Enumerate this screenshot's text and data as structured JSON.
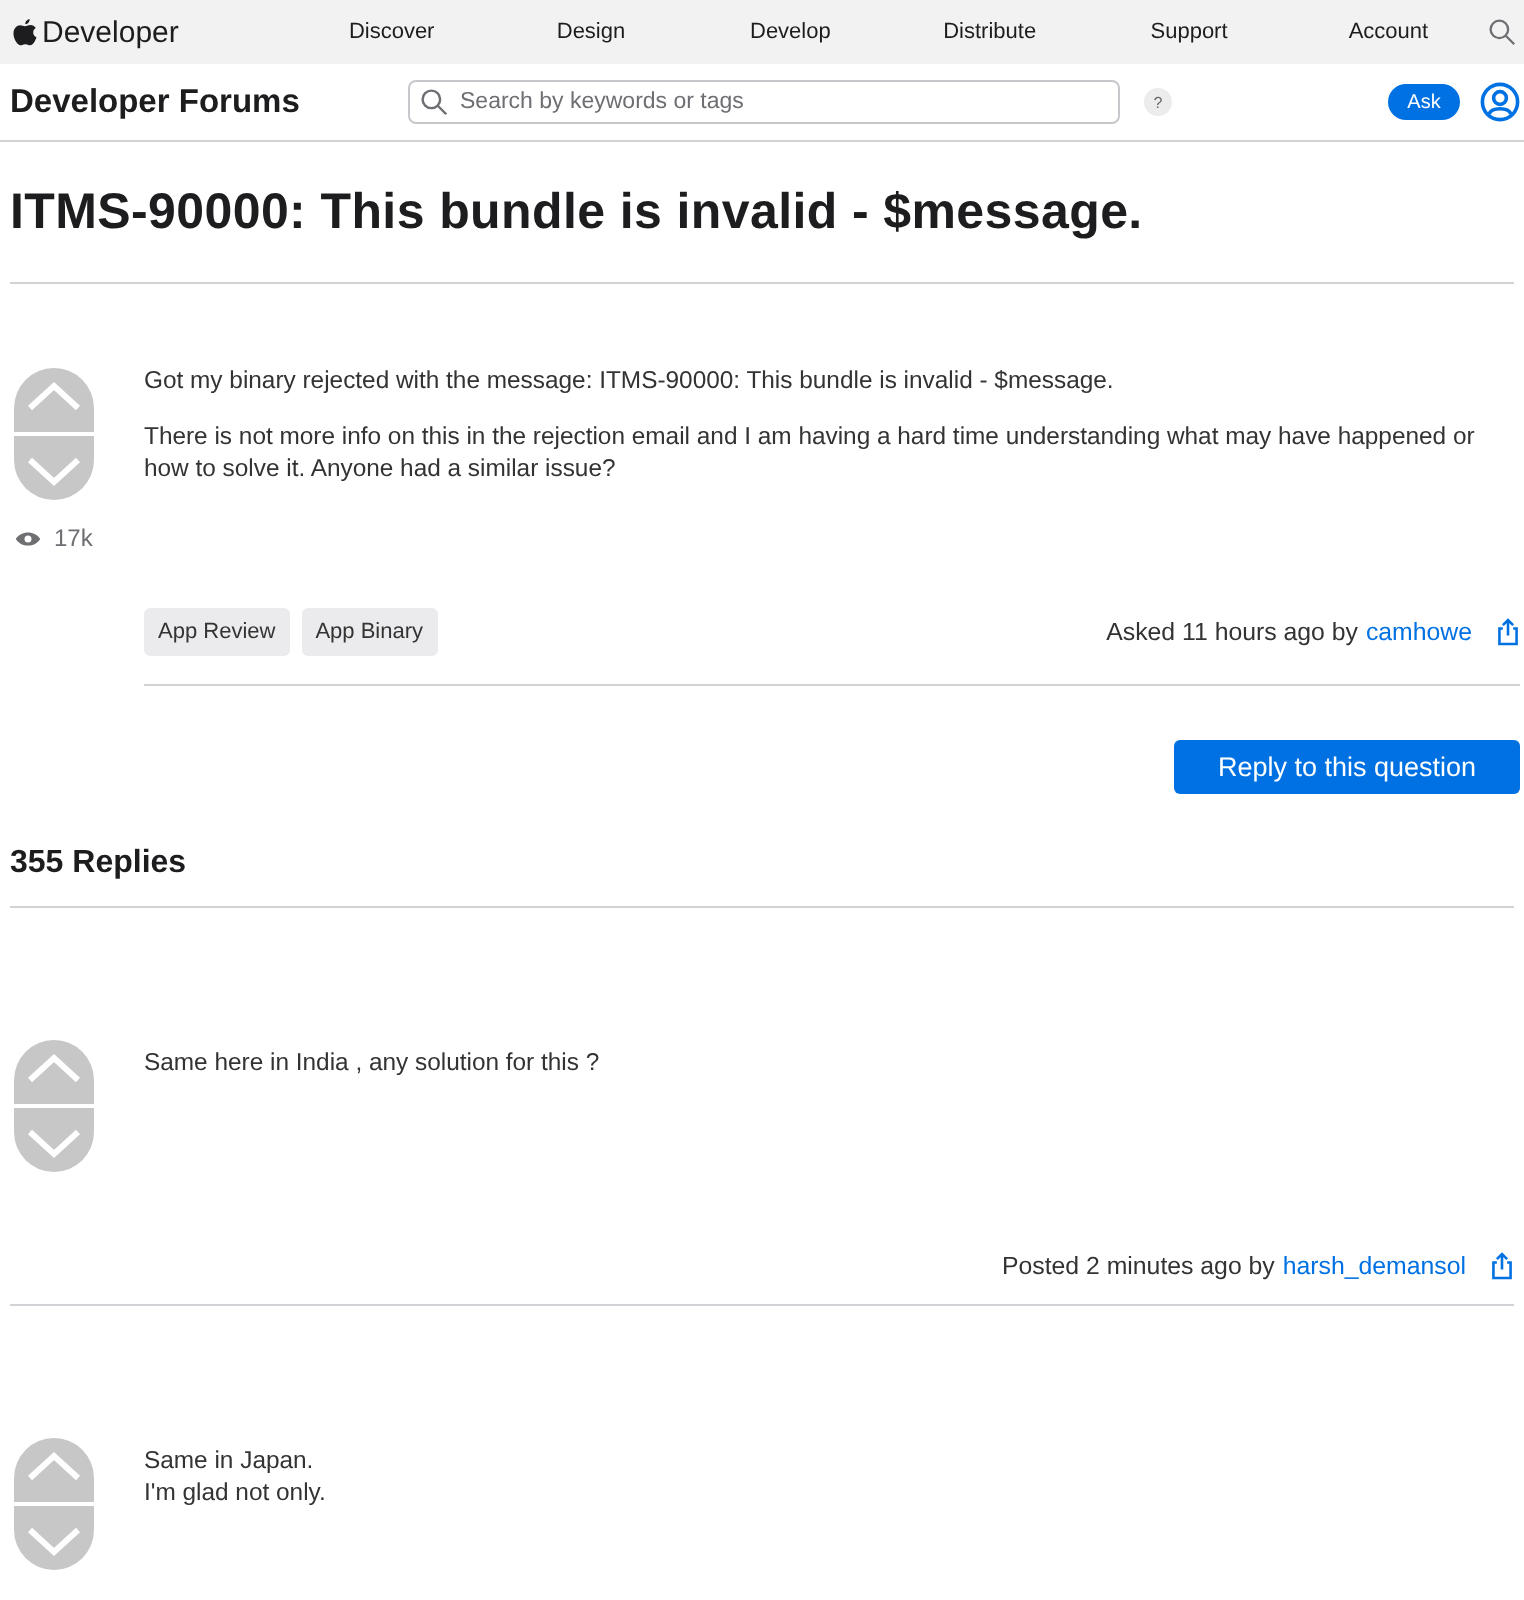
{
  "global_nav": {
    "brand": "Developer",
    "links": [
      "Discover",
      "Design",
      "Develop",
      "Distribute",
      "Support",
      "Account"
    ]
  },
  "forum_bar": {
    "title": "Developer Forums",
    "search": {
      "placeholder": "Search by keywords or tags"
    },
    "help": "?",
    "ask_button": "Ask"
  },
  "question": {
    "title": "ITMS-90000: This bundle is invalid - $message.",
    "paragraphs": [
      "Got my binary rejected with the message: ITMS-90000: This bundle is invalid - $message.",
      "There is not more info on this in the rejection email and I am having a hard time understanding what may have happened or how to solve it. Anyone had a similar issue?"
    ],
    "views": "17k",
    "tags": [
      "App Review",
      "App Binary"
    ],
    "meta": "Asked 11 hours ago by",
    "author": "camhowe"
  },
  "reply_button": "Reply to this question",
  "replies_heading": "355 Replies",
  "replies": [
    {
      "lines": [
        "Same here in India , any solution for this ?"
      ],
      "meta": "Posted 2 minutes ago by",
      "author": "harsh_demansol"
    },
    {
      "lines": [
        "Same in Japan.",
        "I'm glad not only."
      ]
    }
  ]
}
